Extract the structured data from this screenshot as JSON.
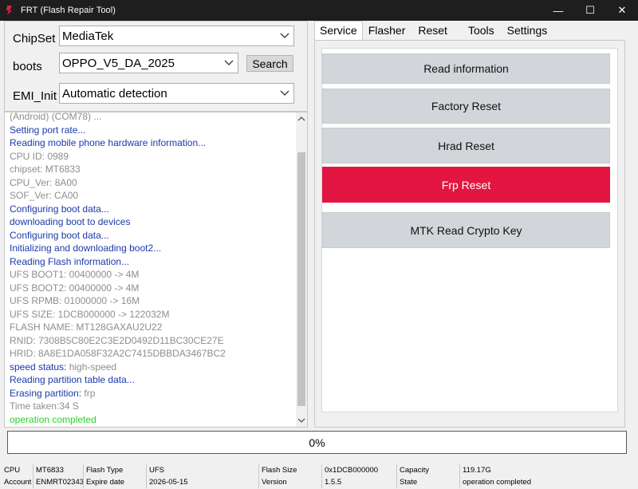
{
  "window": {
    "title": "FRT (Flash Repair Tool)",
    "controls": {
      "minimize": "—",
      "maximize": "☐",
      "close": "✕"
    }
  },
  "config": {
    "chipset_label": "ChipSet",
    "chipset_value": "MediaTek",
    "boots_label": "boots",
    "boots_value": "OPPO_V5_DA_2025",
    "search_label": "Search",
    "emi_label": "EMI_Init",
    "emi_value": "Automatic detection"
  },
  "log": [
    {
      "text": "(Android) (COM78) ...",
      "color": "gray"
    },
    {
      "text": "Setting port rate...",
      "color": "blue"
    },
    {
      "text": "Reading mobile phone hardware information...",
      "color": "blue"
    },
    {
      "text": "CPU ID: 0989",
      "color": "gray"
    },
    {
      "text": "chipset: MT6833",
      "color": "gray"
    },
    {
      "text": "CPU_Ver: 8A00",
      "color": "gray"
    },
    {
      "text": "SOF_Ver: CA00",
      "color": "gray"
    },
    {
      "text": "Configuring boot data...",
      "color": "blue"
    },
    {
      "text": "downloading boot to devices",
      "color": "blue"
    },
    {
      "text": "Configuring boot data...",
      "color": "blue"
    },
    {
      "text": " Initializing and downloading boot2...",
      "color": "blue"
    },
    {
      "text": "Reading Flash information...",
      "color": "blue"
    },
    {
      "text": "UFS BOOT1: 00400000 -> 4M",
      "color": "gray"
    },
    {
      "text": "UFS BOOT2: 00400000 -> 4M",
      "color": "gray"
    },
    {
      "text": "UFS RPMB: 01000000 -> 16M",
      "color": "gray"
    },
    {
      "text": "UFS SIZE: 1DCB000000 -> 122032M",
      "color": "gray"
    },
    {
      "text": "FLASH NAME: MT128GAXAU2U22",
      "color": "gray"
    },
    {
      "text": "RNID: 7308B5C80E2C3E2D0492D11BC30CE27E",
      "color": "gray"
    },
    {
      "text": "HRID: 8A8E1DA058F32A2C7415DBBDA3467BC2",
      "color": "gray"
    },
    {
      "label": "speed status: ",
      "value": "high-speed",
      "color": "blue",
      "valueColor": "gray"
    },
    {
      "text": "Reading partition table data...",
      "color": "blue"
    },
    {
      "label": "Erasing partition: ",
      "value": "frp",
      "color": "blue",
      "valueColor": "gray"
    },
    {
      "text": " Time taken:34 S",
      "color": "gray"
    },
    {
      "text": "operation completed",
      "color": "green"
    }
  ],
  "tabs": [
    {
      "label": "Service",
      "active": true
    },
    {
      "label": "Flasher",
      "active": false
    },
    {
      "label": "Reset",
      "active": false
    },
    {
      "label": "Tools",
      "active": false
    },
    {
      "label": "Settings",
      "active": false
    }
  ],
  "service_buttons": {
    "read_info": "Read information",
    "factory_reset": "Factory Reset",
    "hard_reset": "Hrad Reset",
    "frp_reset": "Frp Reset",
    "mtk_crypto": "MTK Read Crypto Key"
  },
  "progress": {
    "text": "0%",
    "value": 0
  },
  "statusbar": {
    "cpu_label": "CPU",
    "cpu_value": "MT6833",
    "flashtype_label": "Flash Type",
    "flashtype_value": "UFS",
    "flashsize_label": "Flash Size",
    "flashsize_value": "0x1DCB000000",
    "capacity_label": "Capacity",
    "capacity_value": "119.17G",
    "account_label": "Account",
    "account_value": "ENMRT02343",
    "expire_label": "Expire date",
    "expire_value": "2026-05-15",
    "version_label": "Version",
    "version_value": "1.5.5",
    "state_label": "State",
    "state_value": "operation completed"
  },
  "colors": {
    "log_blue": "#1c3aa9",
    "log_gray": "#8e8e8e",
    "log_green": "#2bd12b",
    "frp_red": "#e21640",
    "button_gray": "#d2d5d9",
    "titlebar": "#1e1e1e"
  }
}
